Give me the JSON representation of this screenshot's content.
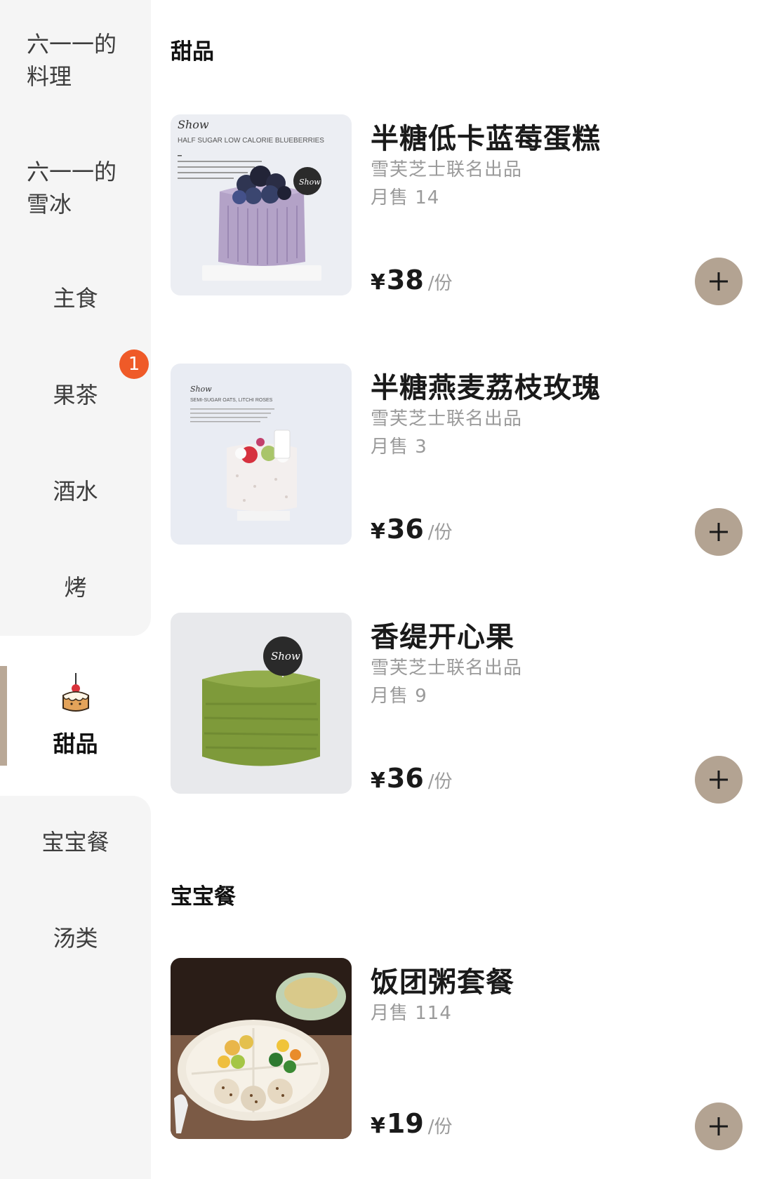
{
  "sidebar": {
    "items": [
      {
        "label": "六一一的料理"
      },
      {
        "label": "六一一的雪冰"
      },
      {
        "label": "主食"
      },
      {
        "label": "果茶",
        "badge": "1"
      },
      {
        "label": "酒水"
      },
      {
        "label": "烤"
      },
      {
        "label": "甜品",
        "icon": "cake-icon",
        "active": true
      },
      {
        "label": "宝宝餐"
      },
      {
        "label": "汤类"
      }
    ]
  },
  "sections": [
    {
      "title": "甜品",
      "items": [
        {
          "name": "半糖低卡蓝莓蛋糕",
          "brand": "雪芙芝士联名出品",
          "sales": "月售 14",
          "currency": "¥",
          "price": "38",
          "unit": "/份",
          "image_text": {
            "logo": "Show",
            "caption": "HALF SUGAR LOW CALORIE BLUEBERRIES"
          }
        },
        {
          "name": "半糖燕麦荔枝玫瑰",
          "brand": "雪芙芝士联名出品",
          "sales": "月售 3",
          "currency": "¥",
          "price": "36",
          "unit": "/份",
          "image_text": {
            "logo": "Show",
            "caption": "SEMI-SUGAR OATS, LITCHI ROSES"
          }
        },
        {
          "name": "香缇开心果",
          "brand": "雪芙芝士联名出品",
          "sales": "月售 9",
          "currency": "¥",
          "price": "36",
          "unit": "/份",
          "image_text": {
            "logo": "Show"
          }
        }
      ]
    },
    {
      "title": "宝宝餐",
      "items": [
        {
          "name": "饭团粥套餐",
          "sales": "月售 114",
          "currency": "¥",
          "price": "19",
          "unit": "/份"
        }
      ]
    }
  ],
  "colors": {
    "accent": "#b3a392",
    "badge": "#ef5a28",
    "sidebar_bg": "#f5f5f5",
    "muted_text": "#9a9a9a"
  },
  "icons": {
    "add": "plus-icon",
    "category": "cake-icon"
  }
}
